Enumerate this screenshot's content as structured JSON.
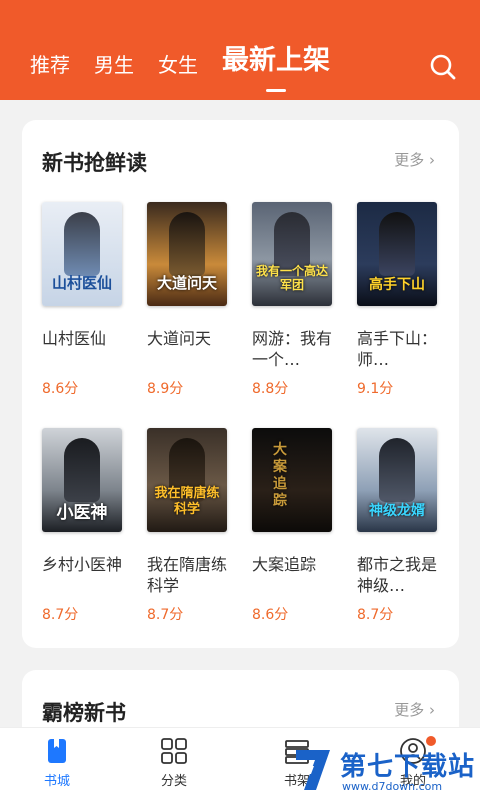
{
  "header": {
    "tabs": [
      {
        "label": "推荐",
        "active": false
      },
      {
        "label": "男生",
        "active": false
      },
      {
        "label": "女生",
        "active": false
      },
      {
        "label": "最新上架",
        "active": true
      }
    ],
    "search_icon": "search-icon",
    "background_color": "#f05a2a"
  },
  "sections": [
    {
      "title": "新书抢鲜读",
      "more_label": "更多 ›",
      "books": [
        {
          "title": "山村医仙",
          "score": "8.6分",
          "cover_text": "山村医仙"
        },
        {
          "title": "大道问天",
          "score": "8.9分",
          "cover_text": "大道问天"
        },
        {
          "title": "网游：我有一个…",
          "score": "8.8分",
          "cover_text": "我有一个高达军团"
        },
        {
          "title": "高手下山：师…",
          "score": "9.1分",
          "cover_text": "高手下山"
        },
        {
          "title": "乡村小医神",
          "score": "8.7分",
          "cover_text": "小医神"
        },
        {
          "title": "我在隋唐练科学",
          "score": "8.7分",
          "cover_text": "我在隋唐练科学"
        },
        {
          "title": "大案追踪",
          "score": "8.6分",
          "cover_text": "大案追踪"
        },
        {
          "title": "都市之我是神级…",
          "score": "8.7分",
          "cover_text": "神级龙婿"
        }
      ]
    },
    {
      "title": "霸榜新书",
      "more_label": "更多 ›"
    }
  ],
  "bottom_nav": [
    {
      "label": "书城",
      "icon": "bookstore-icon",
      "active": true
    },
    {
      "label": "分类",
      "icon": "category-grid-icon",
      "active": false
    },
    {
      "label": "书架",
      "icon": "bookshelf-icon",
      "active": false
    },
    {
      "label": "我的",
      "icon": "profile-icon",
      "active": false
    }
  ],
  "watermark": {
    "title": "第七下载站",
    "url": "www.d7down.com"
  },
  "colors": {
    "accent": "#f05a2a",
    "score": "#ef6a2c",
    "nav_active": "#1e78ff"
  }
}
